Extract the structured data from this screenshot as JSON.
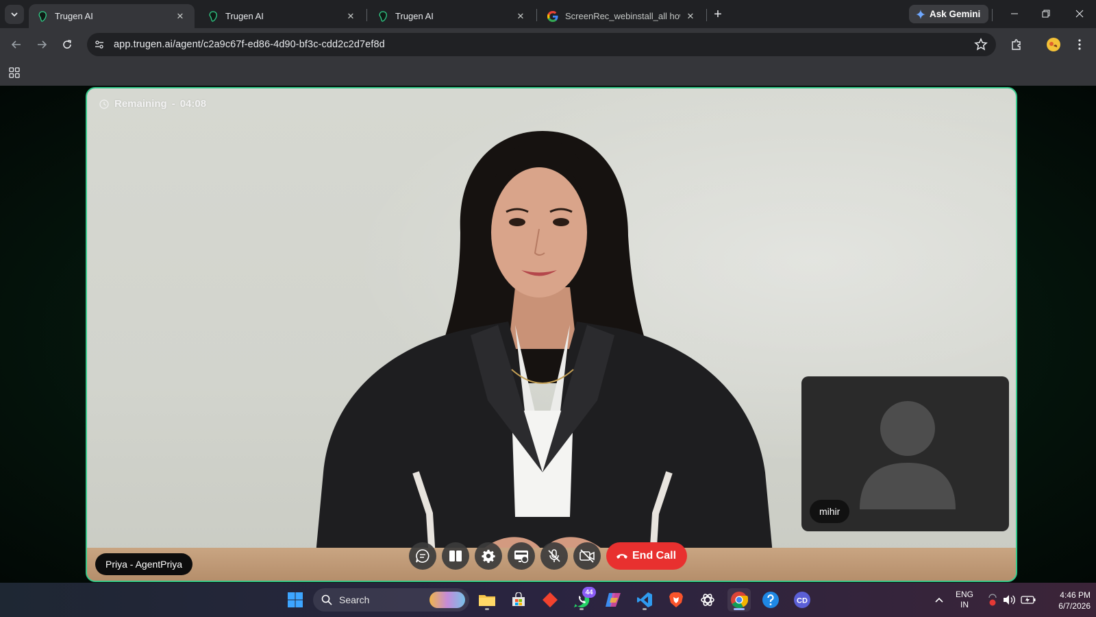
{
  "tabs": [
    {
      "title": "Trugen AI",
      "active": true
    },
    {
      "title": "Trugen AI",
      "active": false
    },
    {
      "title": "Trugen AI",
      "active": false
    },
    {
      "title": "ScreenRec_webinstall_all how to",
      "active": false
    }
  ],
  "gemini_label": "Ask Gemini",
  "address": {
    "url": "app.trugen.ai/agent/c2a9c67f-ed86-4d90-bf3c-cdd2c2d7ef8d"
  },
  "call": {
    "timer_label": "Remaining",
    "timer_separator": "-",
    "timer_value": "04:08",
    "agent_name": "Priya - AgentPriya",
    "self_name": "mihir",
    "end_call_label": "End Call"
  },
  "taskbar": {
    "search_label": "Search",
    "whatsapp_badge": "44",
    "lang_top": "ENG",
    "lang_bottom": "IN",
    "time": "4:46 PM",
    "date": "6/7/2026"
  },
  "colors": {
    "stage_border": "#35c98a",
    "end_call": "#e8302f",
    "tab_active": "#35363a",
    "chrome_dark": "#202124"
  }
}
